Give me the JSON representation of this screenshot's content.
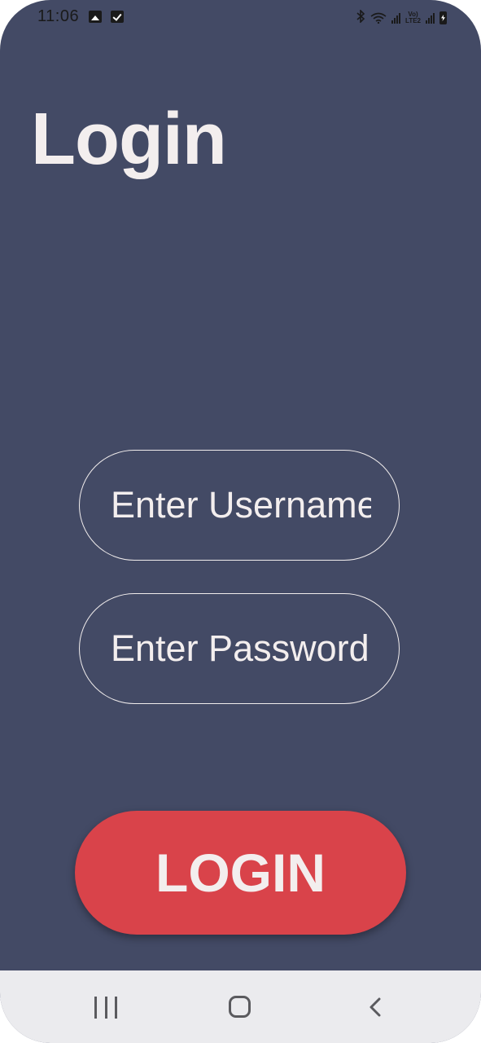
{
  "status_bar": {
    "time": "11:06",
    "left_icons": [
      "gallery-icon",
      "task-check-icon"
    ],
    "right_icons": [
      "bluetooth-icon",
      "wifi-icon",
      "signal-icon",
      "volte-lte2-icon",
      "signal-icon",
      "battery-charging-icon"
    ],
    "lte_label_top": "Vo)",
    "lte_label_bottom": "LTE2"
  },
  "title": "Login",
  "form": {
    "username_placeholder": "Enter Username",
    "password_placeholder": "Enter Password",
    "username_value": "",
    "password_value": ""
  },
  "login_button_label": "LOGIN",
  "nav_bar": {
    "icons": [
      "recent-apps-icon",
      "home-icon",
      "back-icon"
    ]
  },
  "colors": {
    "background": "#434a65",
    "text": "#f3eeee",
    "button": "#d9434a",
    "nav_bar": "#ebebee"
  }
}
